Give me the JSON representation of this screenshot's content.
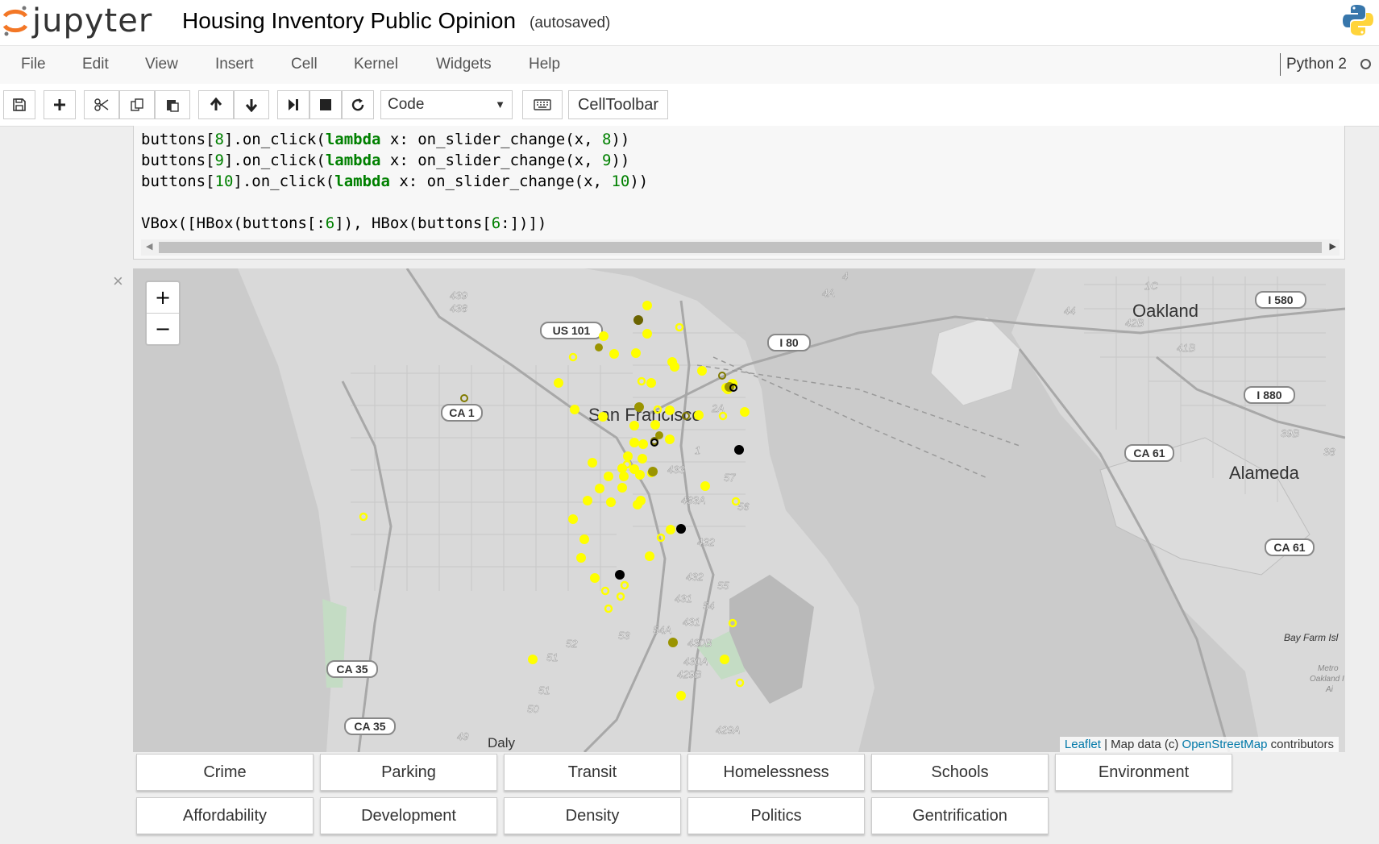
{
  "header": {
    "logo_text": "jupyter",
    "title": "Housing Inventory Public Opinion",
    "autosave": "(autosaved)"
  },
  "menu": [
    "File",
    "Edit",
    "View",
    "Insert",
    "Cell",
    "Kernel",
    "Widgets",
    "Help"
  ],
  "kernel": {
    "name": "Python 2"
  },
  "toolbar": {
    "cell_type": "Code",
    "cell_toolbar_label": "CellToolbar"
  },
  "code": {
    "line1": [
      "buttons[",
      "8",
      "].on_click(",
      "lambda",
      " x: on_slider_change(x, ",
      "8",
      "))"
    ],
    "line2": [
      "buttons[",
      "9",
      "].on_click(",
      "lambda",
      " x: on_slider_change(x, ",
      "9",
      "))"
    ],
    "line3": [
      "buttons[",
      "10",
      "].on_click(",
      "lambda",
      " x: on_slider_change(x, ",
      "10",
      "))"
    ],
    "line4": [
      "VBox([HBox(buttons[:",
      "6",
      "]), HBox(buttons[",
      "6",
      ":])])"
    ]
  },
  "map": {
    "labels": {
      "sf": "San Francisco",
      "oakland": "Oakland",
      "alameda": "Alameda",
      "daly": "Daly",
      "bayfarm": "Bay Farm Isl",
      "metro1": "Metro",
      "metro2": "Oakland I",
      "metro3": "Ai"
    },
    "shields": [
      "US 101",
      "I 80",
      "CA 1",
      "I 580",
      "I 880",
      "CA 61",
      "CA 61",
      "CA 35",
      "CA 35"
    ],
    "route_numbers": [
      "439",
      "438",
      "4",
      "4A",
      "1C",
      "44",
      "42B",
      "41B",
      "39B",
      "38",
      "2A",
      "1",
      "433",
      "57",
      "433A",
      "56",
      "432",
      "432",
      "55",
      "431",
      "54",
      "431",
      "54A",
      "430B",
      "430A",
      "429B",
      "52",
      "51",
      "51",
      "50",
      "49",
      "53",
      "429A"
    ],
    "zoom_in": "+",
    "zoom_out": "−",
    "attribution": {
      "leaflet": "Leaflet",
      "data": "| Map data (c)",
      "osm": "OpenStreetMap",
      "contrib": "contributors"
    },
    "colors": {
      "yellow": "#ffff00",
      "olive": "#807a00",
      "black": "#000000",
      "land": "#d8d8d8",
      "water": "#c8c8c8"
    }
  },
  "buttons": {
    "row1": [
      "Crime",
      "Parking",
      "Transit",
      "Homelessness",
      "Schools",
      "Environment"
    ],
    "row2": [
      "Affordability",
      "Development",
      "Density",
      "Politics",
      "Gentrification"
    ]
  }
}
